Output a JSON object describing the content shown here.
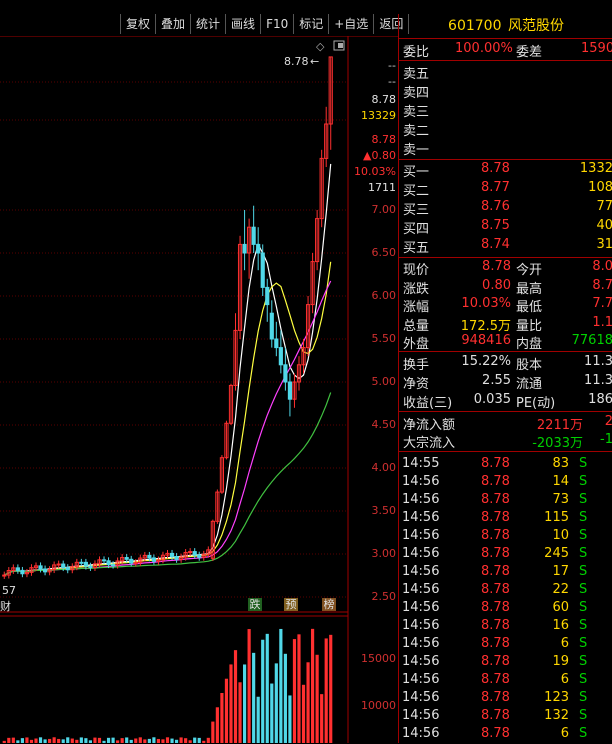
{
  "toolbar": {
    "buttons": [
      "复权",
      "叠加",
      "统计",
      "画线",
      "F10",
      "标记",
      "+自选",
      "返回"
    ]
  },
  "chart": {
    "price_labels": [
      "7.00",
      "6.50",
      "6.00",
      "5.50",
      "5.00",
      "4.50",
      "4.00",
      "3.50",
      "3.00",
      "2.50"
    ],
    "volume_labels": [
      "15000",
      "10000"
    ],
    "top_labels": {
      "high_marker": "8.78",
      "dash1": "--",
      "dash2": "--",
      "v1": "8.78",
      "v2": "13329",
      "v3": "8.78",
      "v4": "▲0.80",
      "v5": "10.03%",
      "v6": "1711"
    },
    "low_label": "57",
    "left_label": "财",
    "tags": [
      "跌",
      "预",
      "榜"
    ],
    "colors": {
      "up": "#ff3030",
      "down": "#50d8e8",
      "ma_white": "#ffffff",
      "ma_yellow": "#ffff40",
      "ma_magenta": "#ff40ff",
      "ma_green": "#40c040"
    }
  },
  "quote": {
    "code": "601700",
    "name": "风范股份",
    "webi_label": "委比",
    "webi_value": "100.00%",
    "wecha_label": "委差",
    "wecha_value": "1590",
    "sell_labels": [
      "卖五",
      "卖四",
      "卖三",
      "卖二",
      "卖一"
    ],
    "buy": [
      {
        "label": "买一",
        "price": "8.78",
        "vol": "1332"
      },
      {
        "label": "买二",
        "price": "8.77",
        "vol": "108"
      },
      {
        "label": "买三",
        "price": "8.76",
        "vol": "77"
      },
      {
        "label": "买四",
        "price": "8.75",
        "vol": "40"
      },
      {
        "label": "买五",
        "price": "8.74",
        "vol": "31"
      }
    ],
    "stats": [
      {
        "l1": "现价",
        "v1": "8.78",
        "l2": "今开",
        "v2": "8.0"
      },
      {
        "l1": "涨跌",
        "v1": "0.80",
        "l2": "最高",
        "v2": "8.7"
      },
      {
        "l1": "涨幅",
        "v1": "10.03%",
        "l2": "最低",
        "v2": "7.7"
      },
      {
        "l1": "总量",
        "v1": "172.5万",
        "l2": "量比",
        "v2": "1.1"
      },
      {
        "l1": "外盘",
        "v1": "948416",
        "l2": "内盘",
        "v2": "77618"
      }
    ],
    "stats2": [
      {
        "l1": "换手",
        "v1": "15.22%",
        "l2": "股本",
        "v2": "11.3"
      },
      {
        "l1": "净资",
        "v1": "2.55",
        "l2": "流通",
        "v2": "11.3"
      },
      {
        "l1": "收益(三)",
        "v1": "0.035",
        "l2": "PE(动)",
        "v2": "186"
      }
    ],
    "flow": [
      {
        "label": "净流入额",
        "v1": "2211万",
        "v2": "2"
      },
      {
        "label": "大宗流入",
        "v1": "-2033万",
        "v2": "-1"
      }
    ],
    "ticks": [
      {
        "t": "14:55",
        "p": "8.78",
        "v": "83",
        "s": "S"
      },
      {
        "t": "14:56",
        "p": "8.78",
        "v": "14",
        "s": "S"
      },
      {
        "t": "14:56",
        "p": "8.78",
        "v": "73",
        "s": "S"
      },
      {
        "t": "14:56",
        "p": "8.78",
        "v": "115",
        "s": "S"
      },
      {
        "t": "14:56",
        "p": "8.78",
        "v": "10",
        "s": "S"
      },
      {
        "t": "14:56",
        "p": "8.78",
        "v": "245",
        "s": "S"
      },
      {
        "t": "14:56",
        "p": "8.78",
        "v": "17",
        "s": "S"
      },
      {
        "t": "14:56",
        "p": "8.78",
        "v": "22",
        "s": "S"
      },
      {
        "t": "14:56",
        "p": "8.78",
        "v": "60",
        "s": "S"
      },
      {
        "t": "14:56",
        "p": "8.78",
        "v": "16",
        "s": "S"
      },
      {
        "t": "14:56",
        "p": "8.78",
        "v": "6",
        "s": "S"
      },
      {
        "t": "14:56",
        "p": "8.78",
        "v": "19",
        "s": "S"
      },
      {
        "t": "14:56",
        "p": "8.78",
        "v": "6",
        "s": "S"
      },
      {
        "t": "14:56",
        "p": "8.78",
        "v": "123",
        "s": "S"
      },
      {
        "t": "14:56",
        "p": "8.78",
        "v": "132",
        "s": "S"
      },
      {
        "t": "14:56",
        "p": "8.78",
        "v": "6",
        "s": "S"
      }
    ]
  }
}
